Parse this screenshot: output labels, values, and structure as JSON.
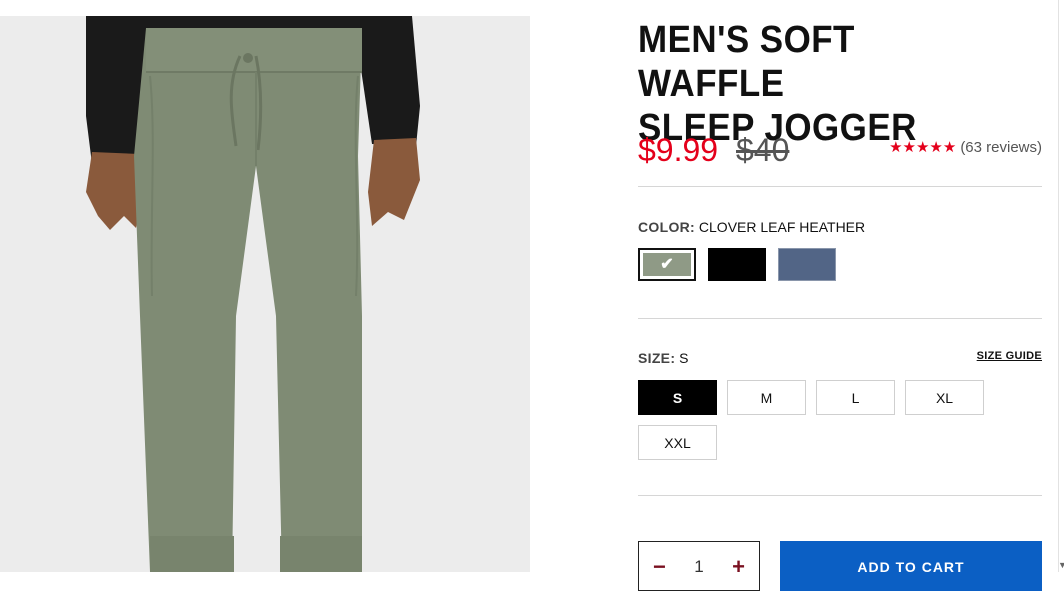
{
  "product": {
    "title_line1": "MEN'S SOFT WAFFLE",
    "title_line2": "SLEEP JOGGER",
    "image_alt": "Men's soft waffle sleep jogger product photo"
  },
  "price": {
    "sale": "$9.99",
    "original": "$40"
  },
  "rating": {
    "stars": "★★★★★",
    "reviews": "(63 reviews)",
    "star_color": "#e4001b"
  },
  "color": {
    "label": "COLOR:",
    "selected": "CLOVER LEAF HEATHER",
    "options": [
      {
        "name": "CLOVER LEAF HEATHER",
        "hex": "#8f9a86",
        "selected": true
      },
      {
        "name": "BLACK",
        "hex": "#000000",
        "selected": false
      },
      {
        "name": "BLUE",
        "hex": "#526586",
        "selected": false
      }
    ],
    "check_glyph": "✔"
  },
  "size": {
    "label": "SIZE:",
    "selected": "S",
    "guide": "SIZE GUIDE",
    "options": [
      "S",
      "M",
      "L",
      "XL",
      "XXL"
    ]
  },
  "quantity": {
    "minus": "−",
    "value": "1",
    "plus": "+"
  },
  "cart": {
    "button": "ADD TO CART",
    "accent": "#0b5fc4"
  }
}
